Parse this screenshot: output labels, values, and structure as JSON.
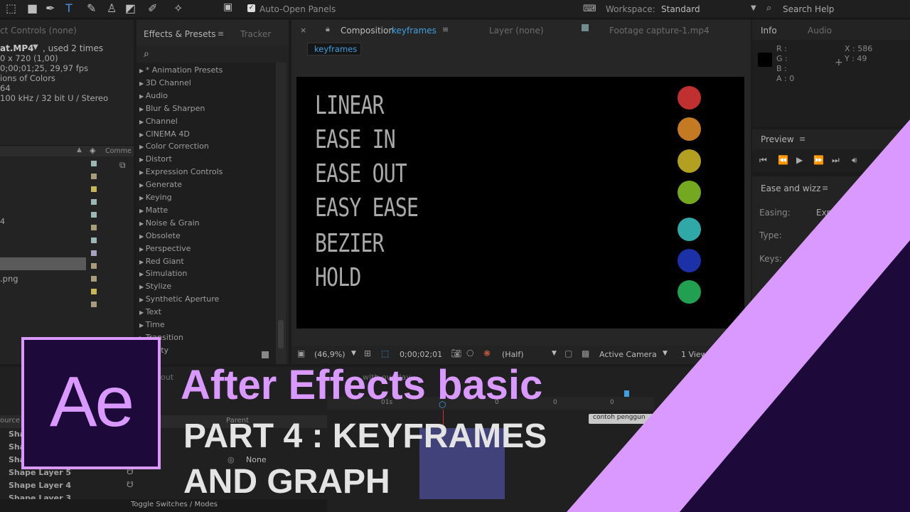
{
  "toolbar": {
    "auto_open_label": "Auto-Open Panels",
    "workspace_label": "Workspace:",
    "workspace_value": "Standard",
    "search_placeholder": "Search Help"
  },
  "project": {
    "tab": "ct Controls (none)",
    "file_name": "at.MP4",
    "file_used": ", used 2 times",
    "lines": [
      "0 x 720 (1,00)",
      "0;00;01;25, 29,97 fps",
      "ions of Colors",
      "64",
      "100 kHz / 32 bit U / Stereo"
    ],
    "column_comment": "Comme",
    "png_item": ".png",
    "swatch_colors": [
      "#9cb8b4",
      "#a89c7c",
      "#c6b85a",
      "#9cb8b4",
      "#9cb8b4",
      "#a89c7c",
      "#9cb8b4",
      "#a4a4c0",
      "#a89c7c",
      "#a89c7c",
      "#c6b85a",
      "#a89c7c"
    ]
  },
  "effects": {
    "tab": "Effects & Presets",
    "tab2": "Tracker",
    "items": [
      "* Animation Presets",
      "3D Channel",
      "Audio",
      "Blur & Sharpen",
      "Channel",
      "CINEMA 4D",
      "Color Correction",
      "Distort",
      "Expression Controls",
      "Generate",
      "Keying",
      "Matte",
      "Noise & Grain",
      "Obsolete",
      "Perspective",
      "Red Giant",
      "Simulation",
      "Stylize",
      "Synthetic Aperture",
      "Text",
      "Time",
      "Transition",
      "Utility"
    ]
  },
  "comp": {
    "tab_prefix": "Composition",
    "tab_name": "keyframes",
    "layer_tab": "Layer  (none)",
    "footage_tab": "Footage  capture-1.mp4",
    "breadcrumb": "keyframes",
    "labels": [
      "LINEAR",
      "EASE IN",
      "EASE OUT",
      "EASY EASE",
      "BEZIER",
      "HOLD"
    ],
    "dot_colors": [
      "#c03030",
      "#c47a22",
      "#b4a020",
      "#74a820",
      "#30a8a8",
      "#1c30a8",
      "#20a050"
    ],
    "zoom": "(46,9%)",
    "timecode": "0;00;02;01",
    "resolution": "(Half)",
    "camera": "Active Camera",
    "views": "1 View"
  },
  "info": {
    "tab": "Info",
    "tab2": "Audio",
    "r": "R :",
    "g": "G :",
    "b": "B :",
    "a": "A : 0",
    "x": "X : 586",
    "y": "Y : 49"
  },
  "preview": {
    "tab": "Preview"
  },
  "ease": {
    "tab": "Ease and wizz",
    "easing_label": "Easing:",
    "easing_value": "Exp",
    "type_label": "Type:",
    "keys_label": "Keys:"
  },
  "timeline": {
    "tab_out": "out",
    "parent_label": "Parent",
    "parent_value": "None",
    "source_label": "ource N",
    "layers": [
      "Shap",
      "Shap",
      "Shap",
      "Shape Layer 5",
      "Shape Layer 4",
      "Shape Layer 3"
    ],
    "ruler": [
      "01s",
      "0",
      "0",
      "0",
      "0",
      "s"
    ],
    "tooltip": "contoh penggun",
    "toggle_label": "Toggle Switches / Modes",
    "overlay_hint": "with overlay"
  },
  "overlay": {
    "logo": "Ae",
    "title": "After Effects basic",
    "subtitle_line1": "PART 4 : KEYFRAMES",
    "subtitle_line2": "AND GRAPH",
    "accent_color": "#d999ff",
    "dark_color": "#1e0a3a"
  }
}
